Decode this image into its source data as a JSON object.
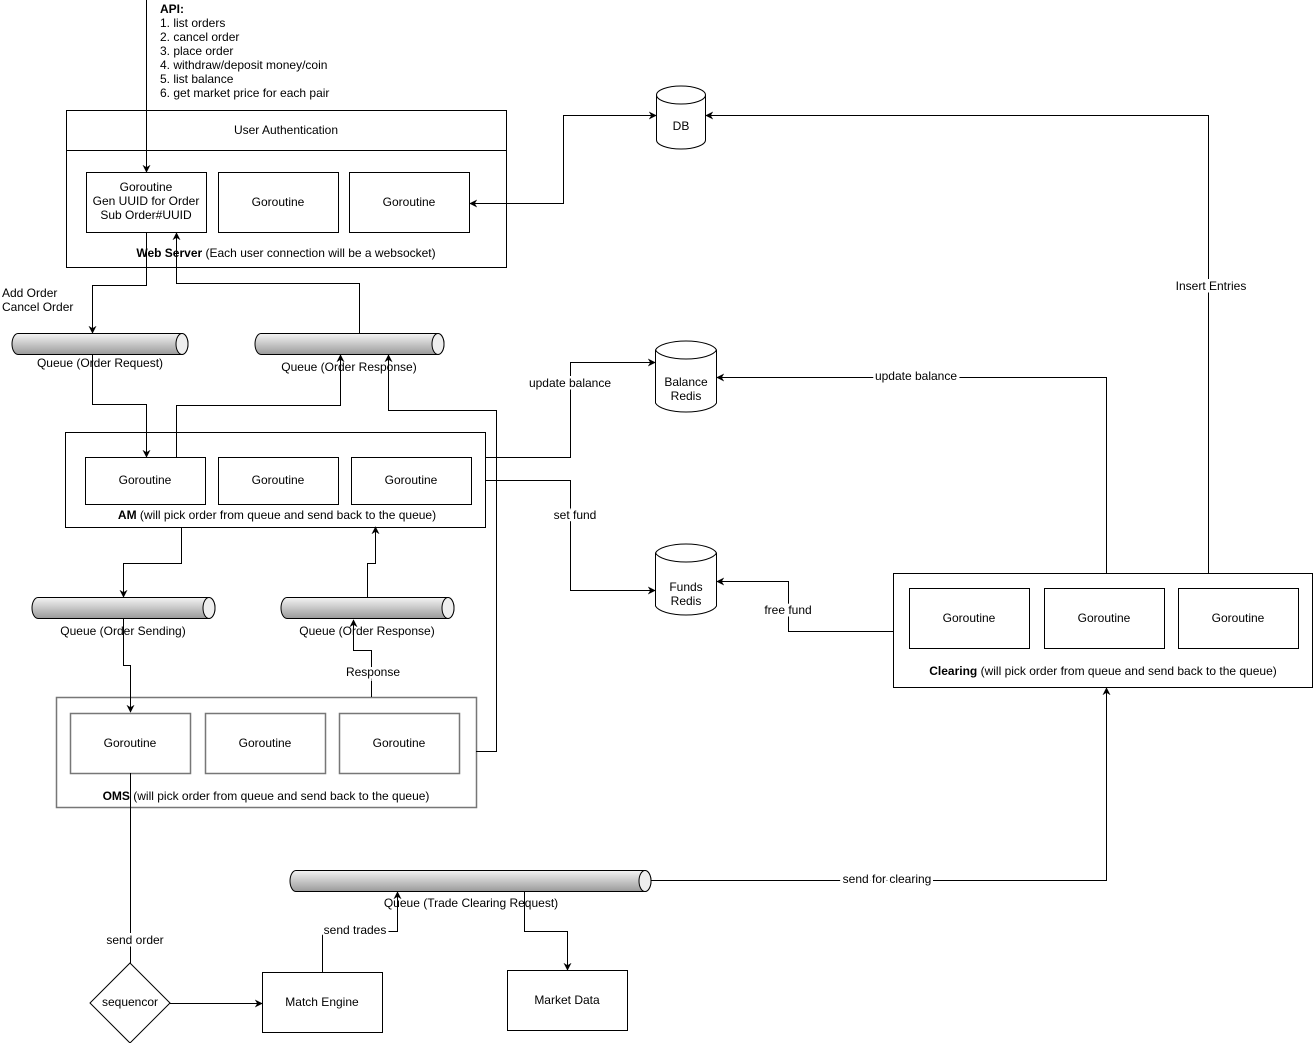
{
  "api": {
    "title": "API:",
    "items": [
      "1. list orders",
      "2. cancel order",
      "3. place order",
      "4. withdraw/deposit money/coin",
      "5. list balance",
      "6. get market price for each pair"
    ]
  },
  "web_server": {
    "header": "User Authentication",
    "goroutine1": [
      "Goroutine",
      "Gen UUID for Order",
      "Sub Order#UUID"
    ],
    "goroutine2": "Goroutine",
    "goroutine3": "Goroutine",
    "label_bold": "Web Server",
    "label_rest": " (Each user connection will be a websocket)"
  },
  "am": {
    "goroutines": [
      "Goroutine",
      "Goroutine",
      "Goroutine"
    ],
    "label_bold": "AM",
    "label_rest": "  (will pick order from queue and send back to the queue)"
  },
  "oms": {
    "goroutines": [
      "Goroutine",
      "Goroutine",
      "Goroutine"
    ],
    "label_bold": "OMS",
    "label_rest": "  (will pick order from queue and send back to the queue)"
  },
  "clearing": {
    "goroutines": [
      "Goroutine",
      "Goroutine",
      "Goroutine"
    ],
    "label_bold": "Clearing",
    "label_rest": " (will pick order from queue and send back to the queue)"
  },
  "queues": {
    "order_request": "Queue (Order Request)",
    "order_response": "Queue (Order Response)",
    "order_sending": "Queue (Order Sending)",
    "order_response2": "Queue (Order Response)",
    "trade_clearing": "Queue (Trade Clearing Request)"
  },
  "stores": {
    "db": "DB",
    "balance": [
      "Balance",
      "Redis"
    ],
    "funds": [
      "Funds",
      "Redis"
    ]
  },
  "nodes": {
    "sequencer": "sequencor",
    "match_engine": "Match Engine",
    "market_data": "Market Data"
  },
  "edges": {
    "add_order": "Add Order",
    "cancel_order": "Cancel Order",
    "update_balance_am": "update balance",
    "set_fund": "set fund",
    "update_balance_clearing": "update balance",
    "free_fund": "free fund",
    "insert_entries": "Insert Entries",
    "response": "Response",
    "send_order": "send order",
    "send_trades": "send trades",
    "send_for_clearing": "send for clearing"
  },
  "colors": {
    "queue_gradient_light": "#f4f4f4",
    "queue_gradient_dark": "#9a9a9a",
    "inner_box_border": "#777777"
  }
}
